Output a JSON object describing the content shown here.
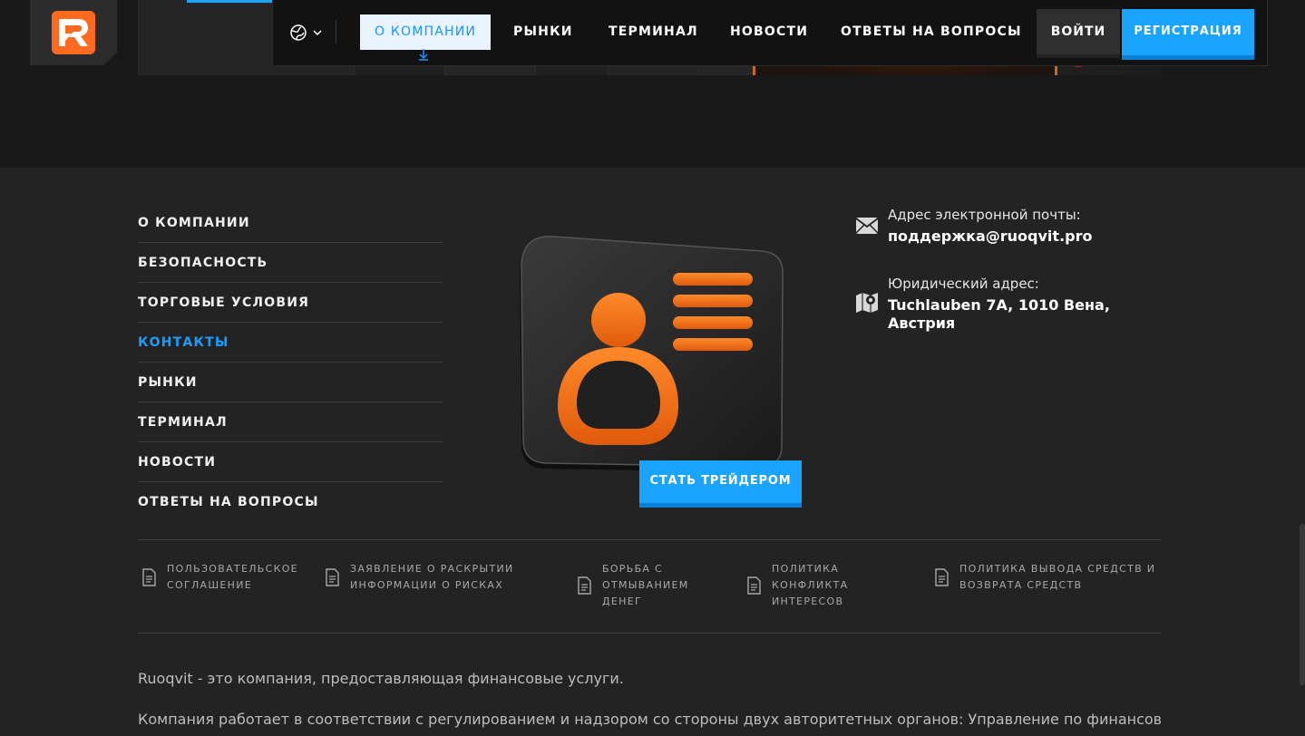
{
  "header": {
    "nav": [
      {
        "label": "О КОМПАНИИ",
        "active": true
      },
      {
        "label": "РЫНКИ"
      },
      {
        "label": "ТЕРМИНАЛ"
      },
      {
        "label": "НОВОСТИ"
      },
      {
        "label": "ОТВЕТЫ НА ВОПРОСЫ"
      }
    ],
    "login_label": "ВОЙТИ",
    "register_label": "РЕГИСТРАЦИЯ",
    "language_icon": "globe-icon"
  },
  "footer": {
    "nav": [
      {
        "label": "О КОМПАНИИ"
      },
      {
        "label": "БЕЗОПАСНОСТЬ"
      },
      {
        "label": "ТОРГОВЫЕ УСЛОВИЯ"
      },
      {
        "label": "КОНТАКТЫ",
        "active": true
      },
      {
        "label": "РЫНКИ"
      },
      {
        "label": "ТЕРМИНАЛ"
      },
      {
        "label": "НОВОСТИ"
      },
      {
        "label": "ОТВЕТЫ НА ВОПРОСЫ"
      }
    ],
    "cta_label": "СТАТЬ ТРЕЙДЕРОМ",
    "contacts": {
      "email_label": "Адрес электронной почты:",
      "email_value": "поддержка@ruoqvit.pro",
      "address_label": "Юридический адрес:",
      "address_value": "Tuchlauben 7A, 1010 Вена, Австрия"
    },
    "policies": [
      {
        "l1": "ПОЛЬЗОВАТЕЛЬСКОЕ",
        "l2": "СОГЛАШЕНИЕ",
        "l3": ""
      },
      {
        "l1": "ЗАЯВЛЕНИЕ О РАСКРЫТИИ",
        "l2": "ИНФОРМАЦИИ О РИСКАХ",
        "l3": ""
      },
      {
        "l1": "БОРЬБА С",
        "l2": "ОТМЫВАНИЕМ",
        "l3": "ДЕНЕГ"
      },
      {
        "l1": "ПОЛИТИКА",
        "l2": "КОНФЛИКТА",
        "l3": "ИНТЕРЕСОВ"
      },
      {
        "l1": "ПОЛИТИКА ВЫВОДА СРЕДСТВ И",
        "l2": "ВОЗВРАТА СРЕДСТВ",
        "l3": ""
      }
    ],
    "about_1": "Ruoqvit - это компания, предоставляющая финансовые услуги.",
    "about_2": "Компания работает в соответствии с регулированием и надзором со стороны двух авторитетных органов: Управление по финансовым"
  },
  "colors": {
    "accent": "#1aa3ff",
    "brand": "#ff6a21",
    "background": "#232323"
  }
}
